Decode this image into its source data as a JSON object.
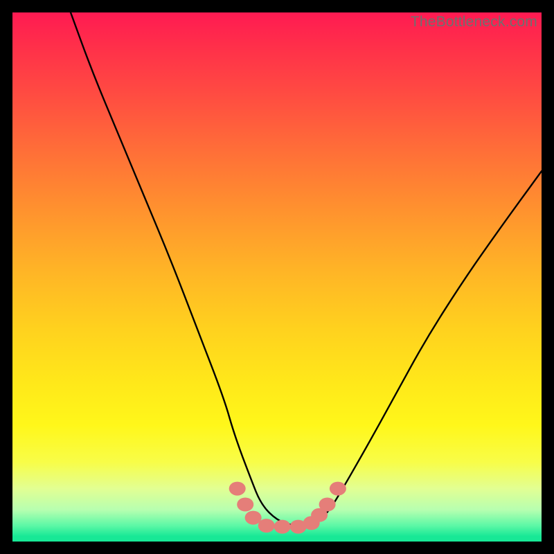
{
  "watermark": "TheBottleneck.com",
  "chart_data": {
    "type": "line",
    "title": "",
    "xlabel": "",
    "ylabel": "",
    "xlim": [
      0,
      100
    ],
    "ylim": [
      0,
      100
    ],
    "series": [
      {
        "name": "curve",
        "x": [
          11,
          15,
          20,
          25,
          30,
          35,
          40,
          42,
          45,
          47,
          50,
          53,
          56,
          58,
          60,
          63,
          67,
          72,
          78,
          85,
          92,
          100
        ],
        "y": [
          100,
          89,
          77,
          65,
          53,
          40,
          27,
          20,
          12,
          7,
          4,
          3,
          3,
          4,
          6,
          11,
          18,
          27,
          38,
          49,
          59,
          70
        ]
      }
    ],
    "markers": {
      "name": "bottom-cluster",
      "color": "#e57e79",
      "points": [
        {
          "x": 42.5,
          "y": 10.0
        },
        {
          "x": 44.0,
          "y": 7.0
        },
        {
          "x": 45.5,
          "y": 4.5
        },
        {
          "x": 48.0,
          "y": 3.0
        },
        {
          "x": 51.0,
          "y": 2.8
        },
        {
          "x": 54.0,
          "y": 2.8
        },
        {
          "x": 56.5,
          "y": 3.5
        },
        {
          "x": 58.0,
          "y": 5.0
        },
        {
          "x": 59.5,
          "y": 7.0
        },
        {
          "x": 61.5,
          "y": 10.0
        }
      ]
    },
    "background_gradient": {
      "top": "#ff1a52",
      "mid": "#ffe81a",
      "bottom": "#18e896"
    }
  }
}
